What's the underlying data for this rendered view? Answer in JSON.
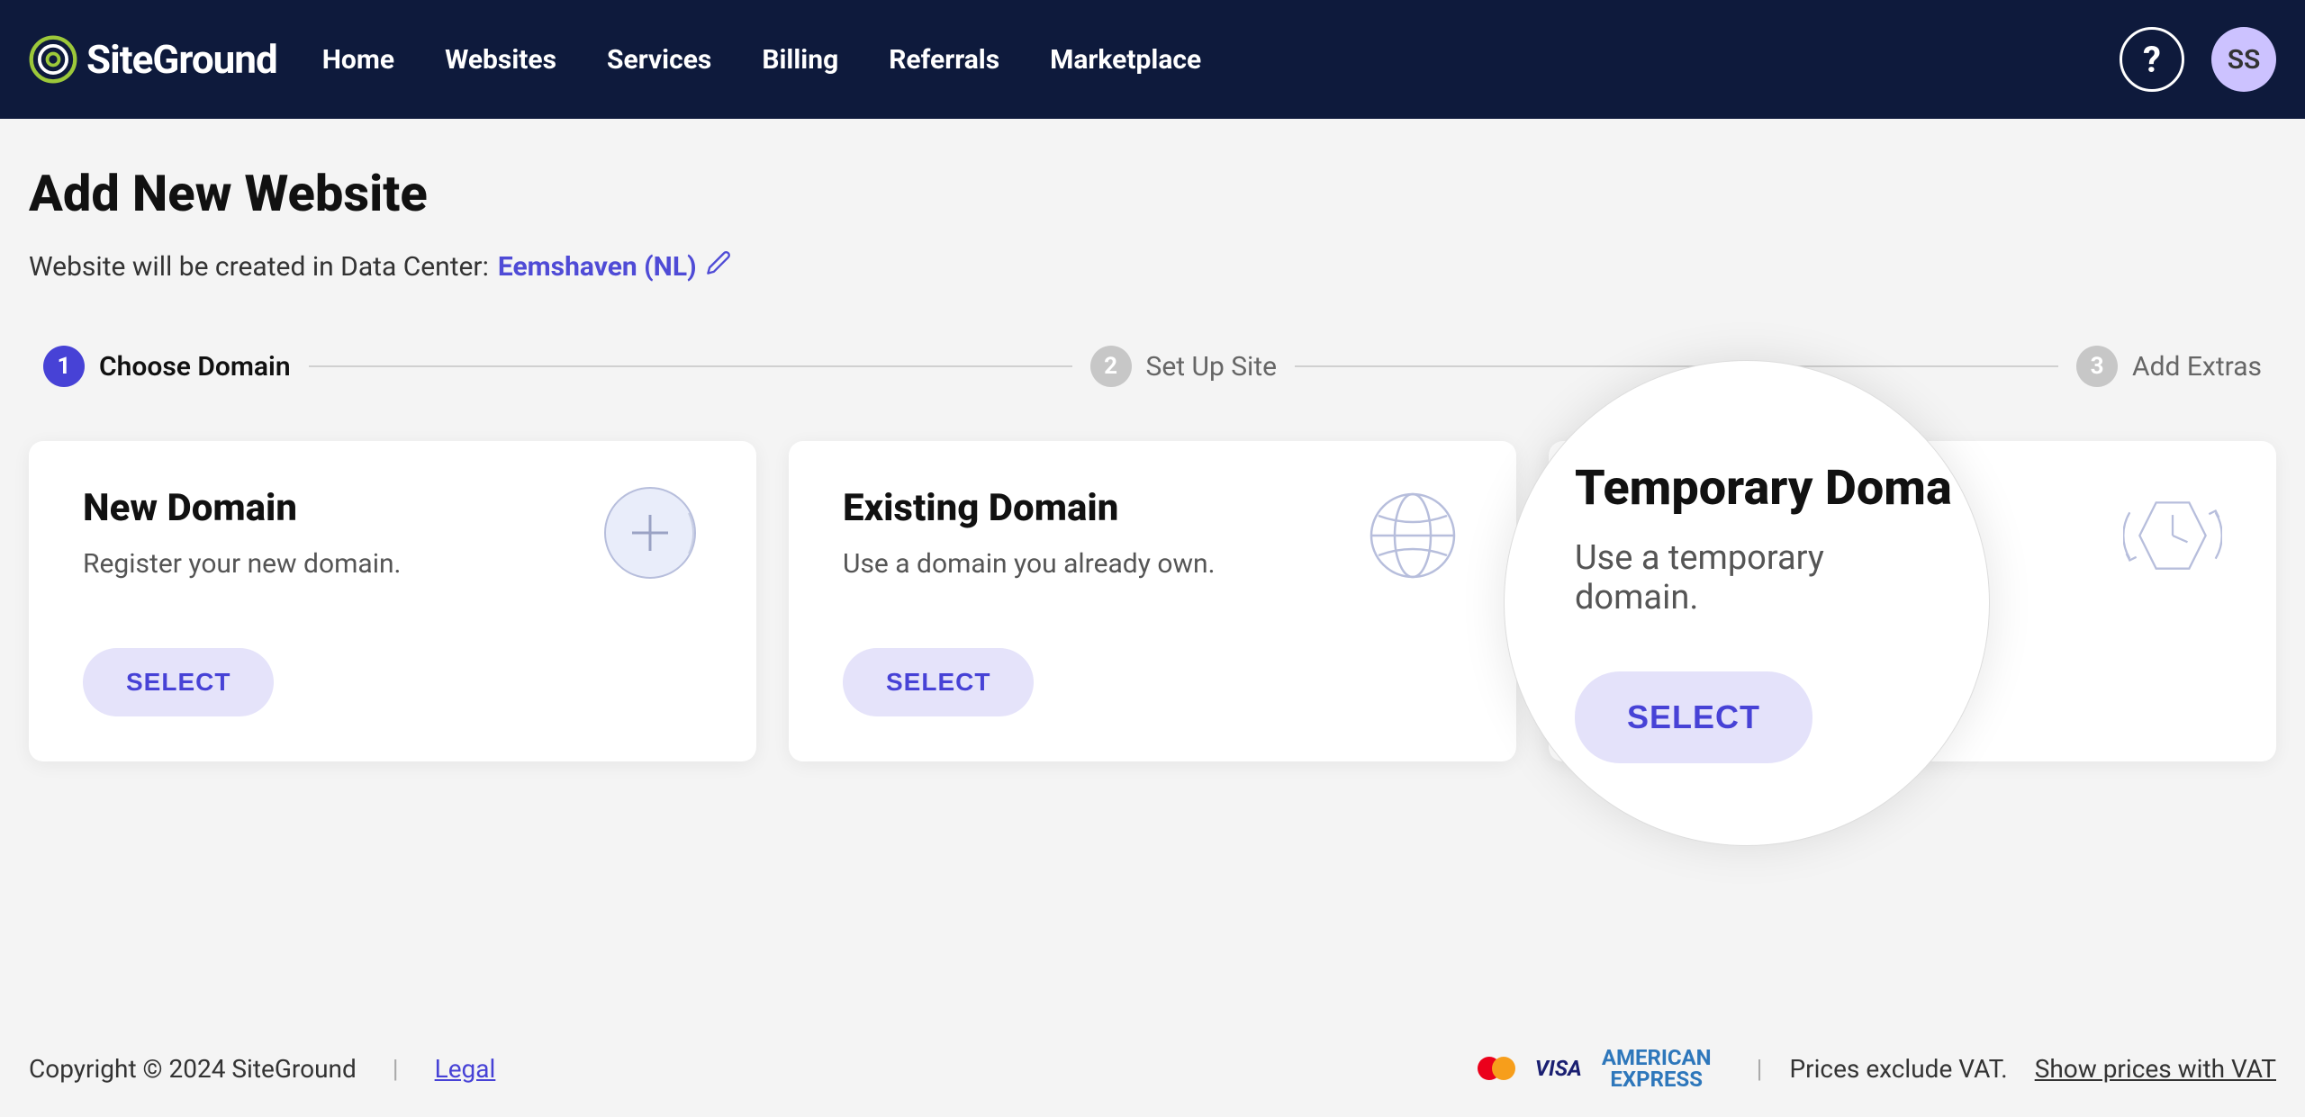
{
  "brand": "SiteGround",
  "nav": {
    "home": "Home",
    "websites": "Websites",
    "services": "Services",
    "billing": "Billing",
    "referrals": "Referrals",
    "marketplace": "Marketplace"
  },
  "help_label": "?",
  "avatar_initials": "SS",
  "page": {
    "title": "Add New Website",
    "dc_prefix": "Website will be created in Data Center:",
    "dc_name": "Eemshaven (NL)"
  },
  "steps": {
    "s1": {
      "num": "1",
      "label": "Choose Domain"
    },
    "s2": {
      "num": "2",
      "label": "Set Up Site"
    },
    "s3": {
      "num": "3",
      "label": "Add Extras"
    }
  },
  "cards": {
    "new_domain": {
      "title": "New Domain",
      "desc": "Register your new domain.",
      "button": "SELECT"
    },
    "existing_domain": {
      "title": "Existing Domain",
      "desc": "Use a domain you already own.",
      "button": "SELECT"
    },
    "temporary_domain": {
      "title": "Temporary Domain",
      "desc": "Use a temporary domain.",
      "button": "SELECT"
    }
  },
  "zoom": {
    "title": "Temporary Doma",
    "desc": "Use a temporary domain.",
    "button": "SELECT"
  },
  "footer": {
    "copyright": "Copyright © 2024 SiteGround",
    "legal": "Legal",
    "vat_text": "Prices exclude VAT.",
    "vat_link": "Show prices with VAT",
    "visa": "VISA",
    "amex": "AMERICAN\nEXPRESS"
  }
}
